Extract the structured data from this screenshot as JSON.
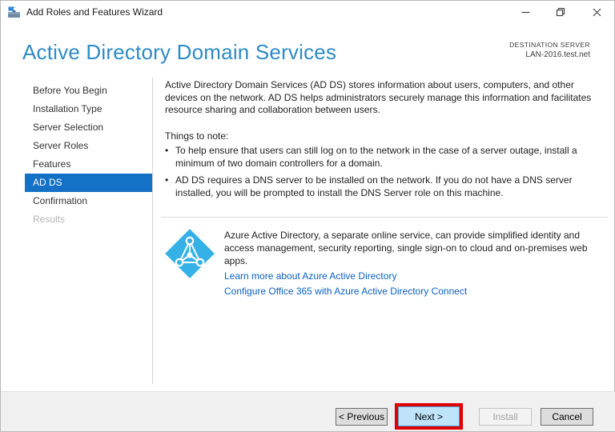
{
  "window": {
    "title": "Add Roles and Features Wizard"
  },
  "header": {
    "page_title": "Active Directory Domain Services",
    "destination_label": "DESTINATION SERVER",
    "destination_server": "LAN-2016.test.net"
  },
  "sidebar": {
    "items": [
      {
        "label": "Before You Begin",
        "state": "normal"
      },
      {
        "label": "Installation Type",
        "state": "normal"
      },
      {
        "label": "Server Selection",
        "state": "normal"
      },
      {
        "label": "Server Roles",
        "state": "normal"
      },
      {
        "label": "Features",
        "state": "normal"
      },
      {
        "label": "AD DS",
        "state": "selected"
      },
      {
        "label": "Confirmation",
        "state": "normal"
      },
      {
        "label": "Results",
        "state": "disabled"
      }
    ]
  },
  "content": {
    "intro": "Active Directory Domain Services (AD DS) stores information about users, computers, and other devices on the network.  AD DS helps administrators securely manage this information and facilitates resource sharing and collaboration between users.",
    "things_heading": "Things to note:",
    "bullets": [
      "To help ensure that users can still log on to the network in the case of a server outage, install a minimum of two domain controllers for a domain.",
      "AD DS requires a DNS server to be installed on the network.  If you do not have a DNS server installed, you will be prompted to install the DNS Server role on this machine."
    ],
    "azure": {
      "description": "Azure Active Directory, a separate online service, can provide simplified identity and access management, security reporting, single sign-on to cloud and on-premises web apps.",
      "link_learn_more": "Learn more about Azure Active Directory",
      "link_configure": "Configure Office 365 with Azure Active Directory Connect"
    }
  },
  "footer": {
    "previous_label": "< Previous",
    "next_label": "Next >",
    "install_label": "Install",
    "cancel_label": "Cancel"
  },
  "icons": {
    "app": "server-manager-toolbox",
    "minimize": "window-minimize",
    "restore": "window-restore",
    "close": "window-close",
    "azure": "azure-active-directory-diamond",
    "bullet": "•"
  },
  "colors": {
    "page_title": "#2e8bc5",
    "sidebar_selected_bg": "#1471c6",
    "link": "#0b61c1",
    "azure_icon": "#35b1e8",
    "annotation_highlight": "#e00000",
    "next_button_bg": "#bfe3f9",
    "footer_bg": "#f0f0f0"
  }
}
